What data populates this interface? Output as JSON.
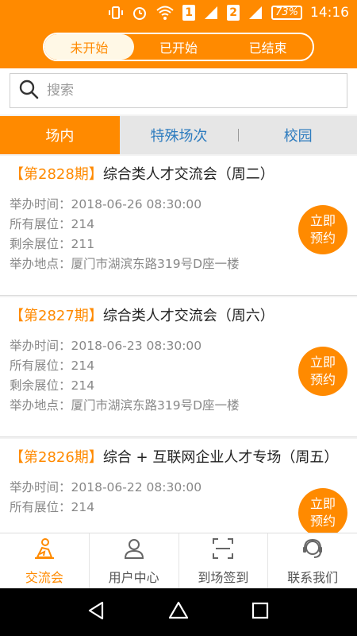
{
  "status_bar": {
    "sim1": "1",
    "sim2": "2",
    "battery": "73%",
    "time": "14:16"
  },
  "header": {
    "segments": [
      "未开始",
      "已开始",
      "已结束"
    ],
    "active_segment": "未开始"
  },
  "search": {
    "placeholder": "搜索"
  },
  "venue_tabs": {
    "items": [
      "场内",
      "特殊场次",
      "校园"
    ],
    "active": "场内"
  },
  "fair_list": [
    {
      "period": "【第2828期】",
      "title": "综合类人才交流会（周二）",
      "time_label": "举办时间：",
      "time": "2018-06-26 08:30:00",
      "total_label": "所有展位：",
      "total": "214",
      "remaining_label": "剩余展位：",
      "remaining": "211",
      "location_label": "举办地点：",
      "location": "厦门市湖滨东路319号D座一楼",
      "button_line1": "立即",
      "button_line2": "预约"
    },
    {
      "period": "【第2827期】",
      "title": "综合类人才交流会（周六）",
      "time_label": "举办时间：",
      "time": "2018-06-23 08:30:00",
      "total_label": "所有展位：",
      "total": "214",
      "remaining_label": "剩余展位：",
      "remaining": "214",
      "location_label": "举办地点：",
      "location": "厦门市湖滨东路319号D座一楼",
      "button_line1": "立即",
      "button_line2": "预约"
    },
    {
      "period": "【第2826期】",
      "title": "综合 + 互联网企业人才专场（周五）",
      "time_label": "举办时间：",
      "time": "2018-06-22 08:30:00",
      "total_label": "所有展位：",
      "total": "214",
      "button_line1": "立即",
      "button_line2": "预约"
    }
  ],
  "bottom_nav": {
    "items": [
      {
        "label": "交流会",
        "icon": "fair-icon"
      },
      {
        "label": "用户中心",
        "icon": "user-icon"
      },
      {
        "label": "到场签到",
        "icon": "scan-icon"
      },
      {
        "label": "联系我们",
        "icon": "headset-icon"
      }
    ],
    "active": "交流会"
  },
  "colors": {
    "accent": "#ff8a00",
    "tab_text": "#2e7cbf",
    "muted_text": "#888888"
  }
}
